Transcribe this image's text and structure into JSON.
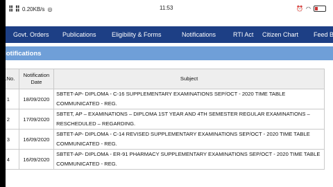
{
  "status": {
    "left_text": "0.20KB/s",
    "time": "11:53",
    "battery_level": 0.3
  },
  "nav": {
    "items": [
      {
        "label": "Govt. Orders"
      },
      {
        "label": "Publications"
      },
      {
        "label": "Eligibility & Forms"
      },
      {
        "label": "Notifications"
      },
      {
        "label": "RTI Act"
      },
      {
        "label": "Citizen Chart"
      },
      {
        "label": "Feed Ba"
      }
    ]
  },
  "section": {
    "title": "Notifications"
  },
  "table": {
    "headers": [
      "S.No.",
      "Notification Date",
      "Subject"
    ],
    "rows": [
      {
        "sno": "1",
        "date": "18/09/2020",
        "subject": "SBTET-AP- DIPLOMA - C-16 SUPPLEMENTARY EXAMINATIONS SEP/OCT - 2020 TIME TABLE COMMUNICATED - REG."
      },
      {
        "sno": "2",
        "date": "17/09/2020",
        "subject": "SBTET, AP – EXAMINATIONS – DIPLOMA 1ST YEAR AND 4TH SEMESTER REGULAR EXAMINATIONS – RESCHEDULED – REGARDING."
      },
      {
        "sno": "3",
        "date": "16/09/2020",
        "subject": "SBTET-AP- DIPLOMA - C-14 REVISED SUPPLEMENTARY EXAMINATIONS SEP/OCT - 2020 TIME TABLE COMMUNICATED - REG."
      },
      {
        "sno": "4",
        "date": "16/09/2020",
        "subject": "SBTET-AP- DIPLOMA - ER-91 PHARMACY SUPPLEMENTARY EXAMINATIONS SEP/OCT - 2020 TIME TABLE COMMUNICATED - REG."
      }
    ]
  }
}
